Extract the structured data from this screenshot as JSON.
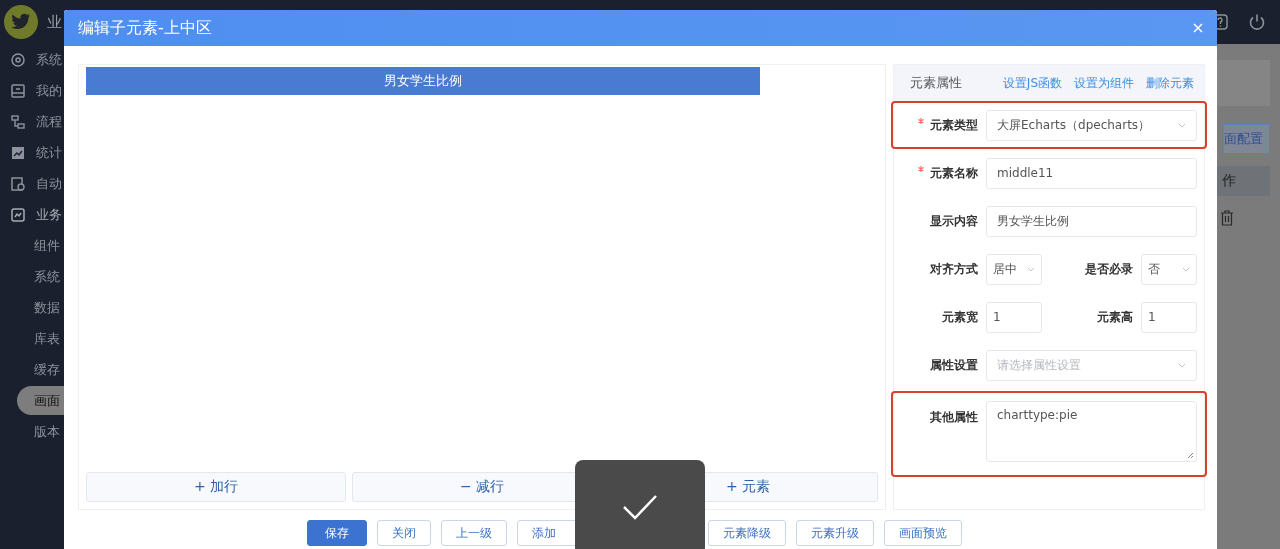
{
  "header": {
    "brand": "业"
  },
  "sidebar": {
    "items": [
      {
        "label": "系统",
        "selected": false
      },
      {
        "label": "我的",
        "selected": false
      },
      {
        "label": "流程",
        "selected": false
      },
      {
        "label": "统计",
        "selected": false
      },
      {
        "label": "自动",
        "selected": false
      },
      {
        "label": "业务",
        "selected": false,
        "expanded": true,
        "children": [
          {
            "label": "组件",
            "selected": false
          },
          {
            "label": "系统",
            "selected": false
          },
          {
            "label": "数据",
            "selected": false
          },
          {
            "label": "库表",
            "selected": false
          },
          {
            "label": "缓存",
            "selected": false
          },
          {
            "label": "画面",
            "selected": true
          },
          {
            "label": "版本",
            "selected": false
          }
        ]
      }
    ]
  },
  "background": {
    "button": "面配置",
    "column_header": "作"
  },
  "dialog": {
    "title": "编辑子元素-上中区",
    "preview": {
      "title": "男女学生比例",
      "buttons": [
        "+ 加行",
        "− 减行",
        "+ 元素"
      ]
    },
    "panel": {
      "title": "元素属性",
      "links": [
        "设置JS函数",
        "设置为组件",
        "删除元素"
      ],
      "rows": [
        {
          "kind": "select",
          "label": "元素类型",
          "required": true,
          "value": "大屏Echarts（dpecharts）",
          "highlight": true
        },
        {
          "kind": "input",
          "label": "元素名称",
          "required": true,
          "value": "middle11",
          "highlight": false
        },
        {
          "kind": "input",
          "label": "显示内容",
          "required": false,
          "value": "男女学生比例",
          "highlight": false
        },
        {
          "kind": "pair",
          "highlight": false,
          "fields": [
            {
              "kind": "select",
              "label": "对齐方式",
              "value": "居中"
            },
            {
              "kind": "select",
              "label": "是否必录",
              "value": "否"
            }
          ]
        },
        {
          "kind": "pair",
          "highlight": false,
          "fields": [
            {
              "kind": "input",
              "label": "元素宽",
              "value": "1"
            },
            {
              "kind": "input",
              "label": "元素高",
              "value": "1"
            }
          ]
        },
        {
          "kind": "select",
          "label": "属性设置",
          "required": false,
          "placeholder": "请选择属性设置",
          "highlight": false
        },
        {
          "kind": "textarea",
          "label": "其他属性",
          "required": false,
          "value": "charttype:pie",
          "highlight": true
        }
      ]
    },
    "footer": [
      {
        "label": "保存",
        "primary": true
      },
      {
        "label": "关闭",
        "primary": false
      },
      {
        "label": "上一级",
        "primary": false
      },
      {
        "label": "添加",
        "primary": false
      },
      {
        "label": "元素降级",
        "primary": false
      },
      {
        "label": "元素升级",
        "primary": false
      },
      {
        "label": "画面预览",
        "primary": false
      }
    ]
  }
}
